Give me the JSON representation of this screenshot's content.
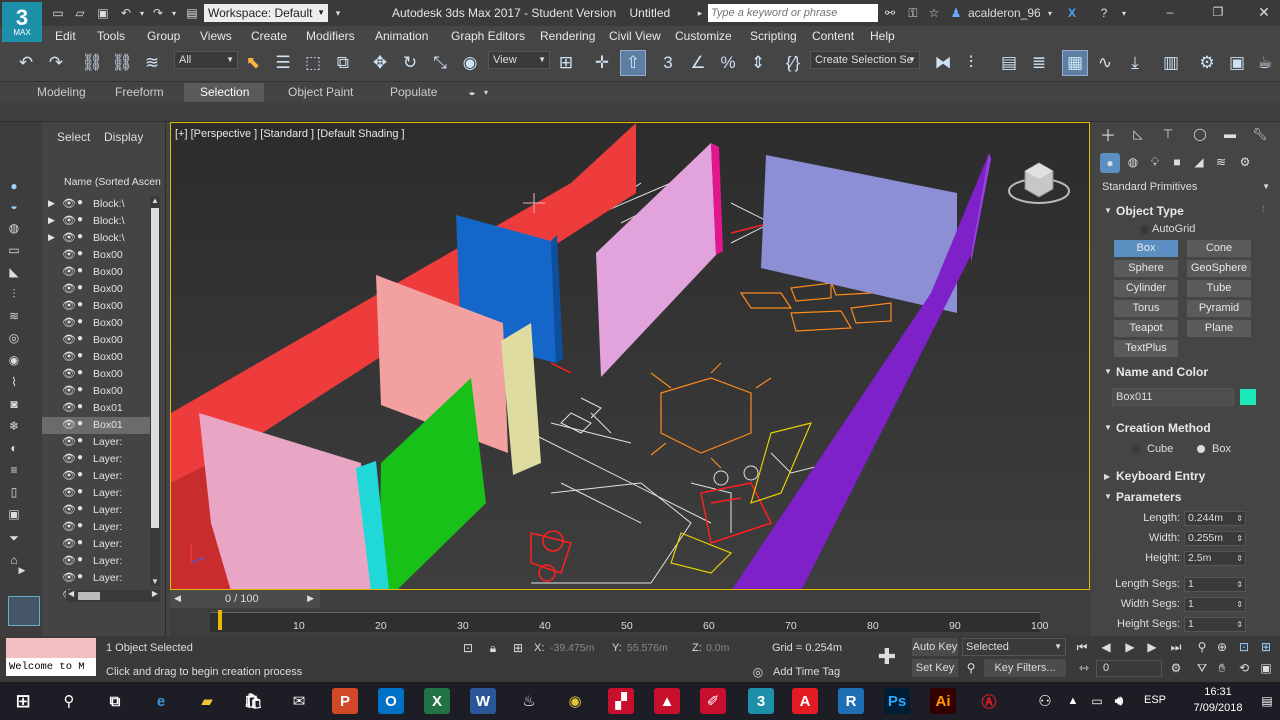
{
  "titlebar": {
    "app_logo": "3",
    "app_logo_sub": "MAX",
    "workspace_label": "Workspace: Default",
    "title": "Autodesk 3ds Max 2017 - Student Version",
    "doc_name": "Untitled",
    "search_placeholder": "Type a keyword or phrase",
    "user": "acalderon_96"
  },
  "menu": [
    "Edit",
    "Tools",
    "Group",
    "Views",
    "Create",
    "Modifiers",
    "Animation",
    "Graph Editors",
    "Rendering",
    "Civil View",
    "Customize",
    "Scripting",
    "Content",
    "Help"
  ],
  "toolbar": {
    "filter_value": "All",
    "refcoord_value": "View",
    "selection_set_value": "Create Selection Se"
  },
  "ribbon_tabs": [
    "Modeling",
    "Freeform",
    "Selection",
    "Object Paint",
    "Populate"
  ],
  "scene_explorer": {
    "tabs": [
      "Select",
      "Display"
    ],
    "column_header": "Name (Sorted Ascen",
    "rows": [
      "Block:\\",
      "Block:\\",
      "Block:\\",
      "Box00",
      "Box00",
      "Box00",
      "Box00",
      "Box00",
      "Box00",
      "Box00",
      "Box00",
      "Box00",
      "Box01",
      "Box01",
      "Layer:",
      "Layer:",
      "Layer:",
      "Layer:",
      "Layer:",
      "Layer:",
      "Layer:",
      "Layer:",
      "Layer:",
      "Layer:"
    ]
  },
  "viewport": {
    "label": "[+] [Perspective ] [Standard ] [Default Shading ]"
  },
  "command_panel": {
    "category_dropdown": "Standard Primitives",
    "object_type_header": "Object Type",
    "autogrid_label": "AutoGrid",
    "primitives": [
      "Box",
      "Cone",
      "Sphere",
      "GeoSphere",
      "Cylinder",
      "Tube",
      "Torus",
      "Pyramid",
      "Teapot",
      "Plane",
      "TextPlus"
    ],
    "name_color_header": "Name and Color",
    "object_name": "Box011",
    "object_color": "#1de9b6",
    "creation_method_header": "Creation Method",
    "creation_methods": [
      "Cube",
      "Box"
    ],
    "keyboard_entry_header": "Keyboard Entry",
    "parameters_header": "Parameters",
    "params": [
      {
        "label": "Length:",
        "value": "0.244m"
      },
      {
        "label": "Width:",
        "value": "0.255m"
      },
      {
        "label": "Height:",
        "value": "2.5m"
      },
      {
        "label": "Length Segs:",
        "value": "1"
      },
      {
        "label": "Width Segs:",
        "value": "1"
      },
      {
        "label": "Height Segs:",
        "value": "1"
      }
    ]
  },
  "timeline": {
    "frame_counter": "0 / 100",
    "ticks": [
      "10",
      "20",
      "30",
      "40",
      "50",
      "60",
      "70",
      "80",
      "90",
      "100"
    ]
  },
  "status": {
    "maxscript_text": "Welcome to M",
    "selected_text": "1 Object Selected",
    "prompt_text": "Click and drag to begin creation process",
    "x_label": "X:",
    "x_value": "-39.475m",
    "y_label": "Y:",
    "y_value": "55.576m",
    "z_label": "Z:",
    "z_value": "0.0m",
    "grid_text": "Grid = 0.254m",
    "add_time_tag": "Add Time Tag",
    "auto_key": "Auto Key",
    "set_key": "Set Key",
    "selected_dropdown": "Selected",
    "key_filters": "Key Filters...",
    "frame_field": "0"
  },
  "taskbar": {
    "language": "ESP",
    "time": "16:31",
    "date": "7/09/2018"
  }
}
